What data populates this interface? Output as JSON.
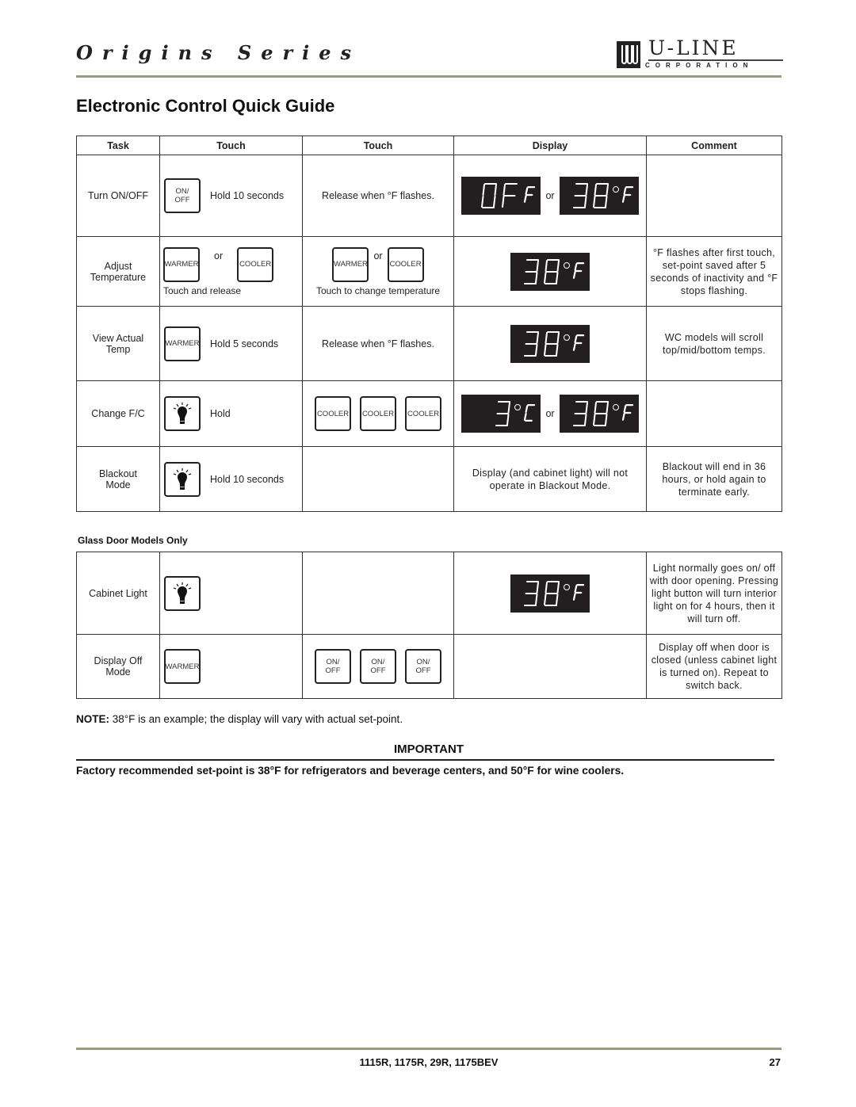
{
  "header": {
    "series_title": "Origins Series",
    "logo": {
      "word": "U-LINE",
      "sub": "CORPORATION",
      "mark_icon": "u-line-logo-icon"
    },
    "page_title": "Electronic Control Quick Guide"
  },
  "table": {
    "headers": [
      "Task",
      "Touch",
      "Touch",
      "Display",
      "Comment"
    ],
    "rows": [
      {
        "task": "Turn ON/OFF",
        "touch1": {
          "buttons": [
            "ON/ OFF"
          ],
          "text": "Hold 10 seconds"
        },
        "touch2": {
          "text": "Release when °F flashes."
        },
        "display": {
          "screens": [
            "0F F",
            "38 °F"
          ],
          "separator": "or"
        },
        "comment": ""
      },
      {
        "task": "Adjust Temperature",
        "touch1": {
          "buttons": [
            "WARMER",
            "COOLER"
          ],
          "separator": "or",
          "caption": "Touch and release"
        },
        "touch2": {
          "buttons": [
            "WARMER",
            "COOLER"
          ],
          "separator": "or",
          "caption": "Touch to change temperature"
        },
        "display": {
          "screens": [
            "38 °F"
          ]
        },
        "comment": "°F flashes after first touch, set-point saved after 5 seconds of inactivity and °F stops flashing."
      },
      {
        "task": "View Actual Temp",
        "touch1": {
          "buttons": [
            "WARMER"
          ],
          "text": "Hold 5 seconds"
        },
        "touch2": {
          "text": "Release when °F flashes."
        },
        "display": {
          "screens": [
            "38 °F"
          ]
        },
        "comment": "WC models will scroll top/mid/bottom temps."
      },
      {
        "task": "Change F/C",
        "touch1": {
          "buttons": [
            "light-bulb-icon"
          ],
          "text": "Hold"
        },
        "touch2": {
          "buttons": [
            "COOLER",
            "COOLER",
            "COOLER"
          ]
        },
        "display": {
          "screens": [
            "3 °C",
            "38 °F"
          ],
          "separator": "or"
        },
        "comment": ""
      },
      {
        "task": "Blackout Mode",
        "touch1": {
          "buttons": [
            "light-bulb-icon"
          ],
          "text": "Hold 10 seconds"
        },
        "touch2": {},
        "display": {
          "text": "Display (and cabinet light) will not operate in Blackout Mode."
        },
        "comment": "Blackout will end in 36 hours, or hold again to terminate early."
      }
    ]
  },
  "glass_section": {
    "label": "Glass Door Models Only",
    "rows": [
      {
        "task": "Cabinet Light",
        "touch1": {
          "buttons": [
            "light-bulb-icon"
          ]
        },
        "touch2": {},
        "display": {
          "screens": [
            "38 °F"
          ]
        },
        "comment": "Light normally goes on/ off with door opening. Pressing light button will turn interior light on for 4 hours, then it will turn off."
      },
      {
        "task": "Display Off Mode",
        "touch1": {
          "buttons": [
            "WARMER"
          ]
        },
        "touch2": {
          "buttons": [
            "ON/ OFF",
            "ON/ OFF",
            "ON/ OFF"
          ]
        },
        "display": {},
        "comment": "Display off when door is closed (unless cabinet light is turned on). Repeat to switch back."
      }
    ]
  },
  "note": {
    "label": "NOTE:",
    "text": " 38°F is an example; the display will vary with actual set-point."
  },
  "important": {
    "heading": "IMPORTANT",
    "text": "Factory recommended set-point is 38°F for refrigerators and beverage centers, and 50°F for wine coolers."
  },
  "footer": {
    "models": "1115R, 1175R, 29R, 1175BEV",
    "page_number": "27"
  },
  "colors": {
    "rule": "#9a9a7e",
    "lcd_bg": "#231f20",
    "lcd_segment": "#ffffff"
  }
}
